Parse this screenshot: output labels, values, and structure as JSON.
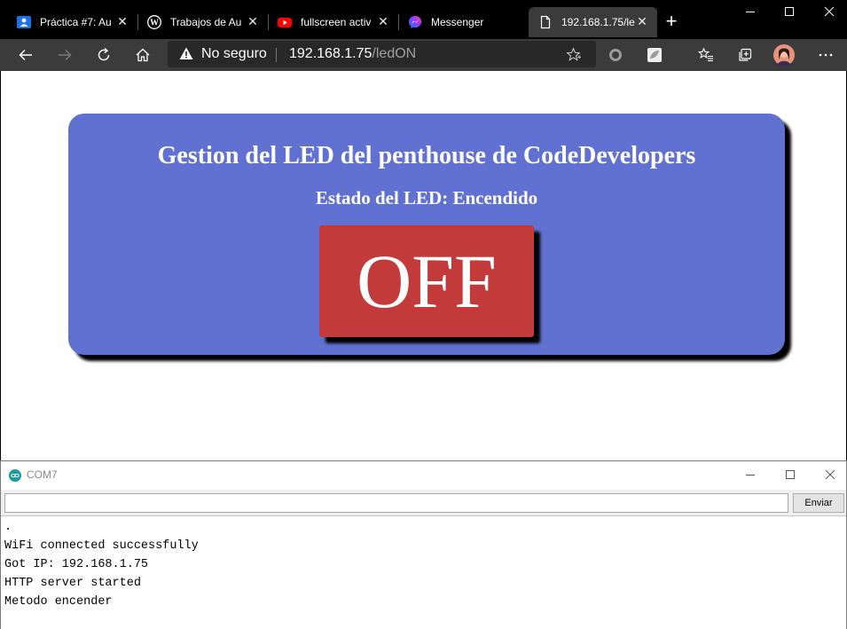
{
  "browser": {
    "tabs": [
      {
        "title": "Práctica #7: Au",
        "icon": "classroom-icon"
      },
      {
        "title": "Trabajos de Au",
        "icon": "wordpress-icon"
      },
      {
        "title": "fullscreen activ",
        "icon": "youtube-icon"
      },
      {
        "title": "Messenger",
        "icon": "messenger-icon"
      },
      {
        "title": "192.168.1.75/le",
        "icon": "page-icon",
        "active": true
      }
    ],
    "address": {
      "security_label": "No seguro",
      "host": "192.168.1.75",
      "path": "/ledON"
    }
  },
  "page": {
    "title": "Gestion del LED del penthouse de CodeDevelopers",
    "status": "Estado del LED: Encendido",
    "button_label": "OFF"
  },
  "serial_monitor": {
    "title": "COM7",
    "input_value": "",
    "send_label": "Enviar",
    "lines": [
      ".",
      "WiFi connected successfully",
      "Got IP: 192.168.1.75",
      "HTTP server started",
      "Metodo encender"
    ]
  },
  "colors": {
    "card": "#6171d1",
    "off_button": "#c23a3a",
    "tabbar": "#000000",
    "toolbar": "#3b3b3b"
  }
}
